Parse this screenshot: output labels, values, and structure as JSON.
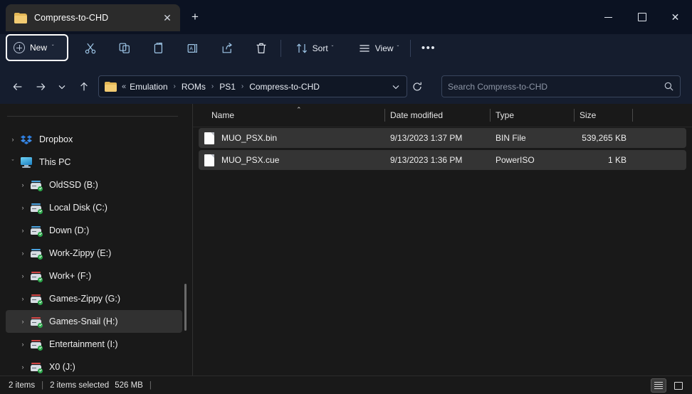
{
  "window": {
    "tab_title": "Compress-to-CHD",
    "tab_icon": "folder-icon",
    "close_tab_glyph": "✕",
    "new_tab_glyph": "+",
    "controls": {
      "minimize": "minimize-icon",
      "maximize": "maximize-icon",
      "close": "✕"
    }
  },
  "toolbar": {
    "new_label": "New",
    "new_chevron": "ˇ",
    "cut_label": "Cut",
    "copy_label": "Copy",
    "paste_label": "Paste",
    "rename_label": "Rename",
    "share_label": "Share",
    "delete_label": "Delete",
    "sort_label": "Sort",
    "sort_chevron": "ˇ",
    "view_label": "View",
    "view_chevron": "ˇ",
    "more_label": "•••"
  },
  "address": {
    "back_glyph": "←",
    "forward_glyph": "→",
    "recent_glyph": "ˇ",
    "up_glyph": "↑",
    "folder_icon": "folder-icon",
    "ellipsis": "«",
    "crumbs": [
      {
        "label": "Emulation"
      },
      {
        "label": "ROMs"
      },
      {
        "label": "PS1"
      },
      {
        "label": "Compress-to-CHD"
      }
    ],
    "separator": "›",
    "dropdown_chevron": "ˇ",
    "refresh_glyph": "↻"
  },
  "search": {
    "placeholder": "Search Compress-to-CHD",
    "value": "",
    "icon": "search-icon"
  },
  "sidebar": {
    "items": [
      {
        "label": "Dropbox",
        "icon": "dropbox-icon",
        "indent": false,
        "selected": false,
        "expanded": false,
        "chevron": "›"
      },
      {
        "label": "This PC",
        "icon": "pc-icon",
        "indent": false,
        "selected": false,
        "expanded": true,
        "chevron": "ˇ"
      },
      {
        "label": "OldSSD (B:)",
        "icon": "drive-icon",
        "indent": true,
        "selected": false,
        "expanded": false,
        "chevron": "›",
        "bar_color": "#4aa3e0"
      },
      {
        "label": "Local Disk (C:)",
        "icon": "drive-icon",
        "indent": true,
        "selected": false,
        "expanded": false,
        "chevron": "›",
        "bar_color": "#4aa3e0"
      },
      {
        "label": "Down (D:)",
        "icon": "drive-icon",
        "indent": true,
        "selected": false,
        "expanded": false,
        "chevron": "›",
        "bar_color": "#4aa3e0"
      },
      {
        "label": "Work-Zippy (E:)",
        "icon": "drive-icon",
        "indent": true,
        "selected": false,
        "expanded": false,
        "chevron": "›",
        "bar_color": "#4aa3e0"
      },
      {
        "label": "Work+ (F:)",
        "icon": "drive-icon",
        "indent": true,
        "selected": false,
        "expanded": false,
        "chevron": "›",
        "bar_color": "#d14545"
      },
      {
        "label": "Games-Zippy (G:)",
        "icon": "drive-icon",
        "indent": true,
        "selected": false,
        "expanded": false,
        "chevron": "›",
        "bar_color": "#d14545"
      },
      {
        "label": "Games-Snail (H:)",
        "icon": "drive-icon",
        "indent": true,
        "selected": true,
        "expanded": false,
        "chevron": "›",
        "bar_color": "#d14545"
      },
      {
        "label": "Entertainment (I:)",
        "icon": "drive-icon",
        "indent": true,
        "selected": false,
        "expanded": false,
        "chevron": "›",
        "bar_color": "#d14545"
      },
      {
        "label": "X0 (J:)",
        "icon": "drive-icon",
        "indent": true,
        "selected": false,
        "expanded": false,
        "chevron": "›",
        "bar_color": "#d14545"
      }
    ]
  },
  "filelist": {
    "columns": [
      {
        "key": "name",
        "label": "Name",
        "sorted": "asc",
        "sort_glyph": "⌃"
      },
      {
        "key": "date",
        "label": "Date modified"
      },
      {
        "key": "type",
        "label": "Type"
      },
      {
        "key": "size",
        "label": "Size",
        "align": "right"
      }
    ],
    "rows": [
      {
        "name": "MUO_PSX.bin",
        "date": "9/13/2023 1:37 PM",
        "type": "BIN File",
        "size": "539,265 KB",
        "icon": "file-icon",
        "selected": true
      },
      {
        "name": "MUO_PSX.cue",
        "date": "9/13/2023 1:36 PM",
        "type": "PowerISO",
        "size": "1 KB",
        "icon": "file-icon",
        "selected": true
      }
    ]
  },
  "status": {
    "item_count": "2 items",
    "separator": "|",
    "selection": "2 items selected",
    "selection_size": "526 MB",
    "trailing_separator": "|",
    "view_details_icon": "details-view-icon",
    "view_icons_icon": "large-icons-view-icon"
  },
  "colors": {
    "titlebar": "#0b1222",
    "toolbar": "#151d2e",
    "content": "#191919",
    "selection": "#343434",
    "accent": "#4aa3e0",
    "folder": "#f2cb72"
  }
}
